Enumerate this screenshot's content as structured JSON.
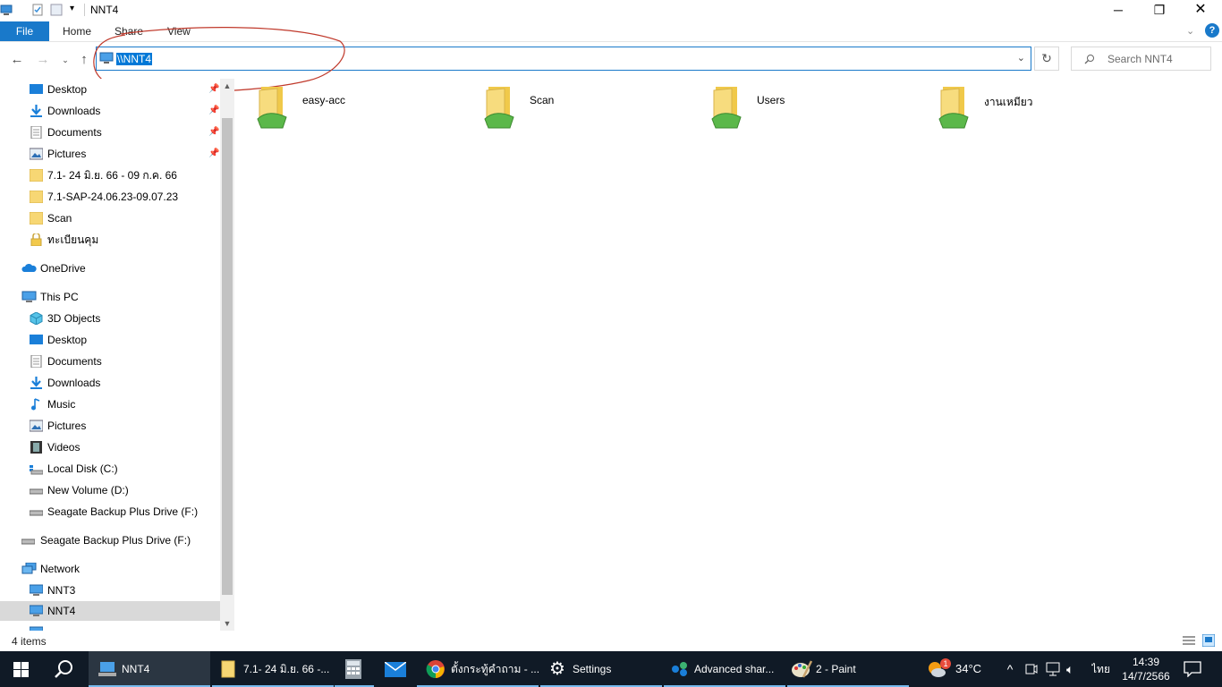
{
  "window": {
    "title": "NNT4"
  },
  "ribbon": {
    "tabs": [
      "File",
      "Home",
      "Share",
      "View"
    ]
  },
  "address": {
    "value": "\\\\NNT4"
  },
  "search": {
    "placeholder": "Search NNT4"
  },
  "sidebar": {
    "quick_access": [
      {
        "label": "Desktop",
        "icon": "desktop-icon",
        "pinned": true
      },
      {
        "label": "Downloads",
        "icon": "download-icon",
        "pinned": true
      },
      {
        "label": "Documents",
        "icon": "documents-icon",
        "pinned": true
      },
      {
        "label": "Pictures",
        "icon": "pictures-icon",
        "pinned": true
      },
      {
        "label": "7.1- 24 มิ.ย. 66 - 09 ก.ค. 66",
        "icon": "folder-icon"
      },
      {
        "label": "7.1-SAP-24.06.23-09.07.23",
        "icon": "folder-icon"
      },
      {
        "label": "Scan",
        "icon": "folder-icon"
      },
      {
        "label": "ทะเบียนคุม",
        "icon": "lock-folder-icon"
      }
    ],
    "onedrive": "OneDrive",
    "this_pc": "This PC",
    "this_pc_items": [
      {
        "label": "3D Objects",
        "icon": "3d-objects-icon"
      },
      {
        "label": "Desktop",
        "icon": "desktop-icon"
      },
      {
        "label": "Documents",
        "icon": "documents-icon"
      },
      {
        "label": "Downloads",
        "icon": "download-icon"
      },
      {
        "label": "Music",
        "icon": "music-icon"
      },
      {
        "label": "Pictures",
        "icon": "pictures-icon"
      },
      {
        "label": "Videos",
        "icon": "videos-icon"
      },
      {
        "label": "Local Disk (C:)",
        "icon": "local-disk-icon"
      },
      {
        "label": "New Volume (D:)",
        "icon": "drive-icon"
      },
      {
        "label": "Seagate Backup Plus Drive (F:)",
        "icon": "drive-icon"
      }
    ],
    "external_drive": "Seagate Backup Plus Drive (F:)",
    "network": "Network",
    "network_items": [
      "NNT3",
      "NNT4"
    ]
  },
  "content": {
    "shares": [
      "easy-acc",
      "Scan",
      "Users",
      "งานเหมียว"
    ]
  },
  "status": {
    "count": "4 items"
  },
  "taskbar": {
    "items": [
      "NNT4",
      "7.1- 24 มิ.ย. 66 -...",
      "",
      "",
      "ตั้งกระทู้คำถาม - ...",
      "Settings",
      "Advanced shar...",
      "2 - Paint"
    ],
    "weather": "34°C",
    "weather_badge": "1",
    "language": "ไทย",
    "time": "14:39",
    "date": "14/7/2566"
  }
}
